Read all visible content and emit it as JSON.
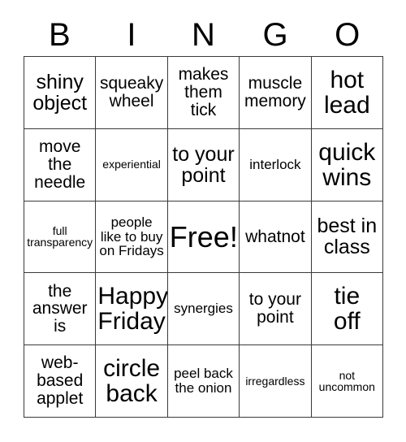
{
  "card": {
    "header_letters": [
      "B",
      "I",
      "N",
      "G",
      "O"
    ],
    "columns": 5,
    "rows": 5,
    "free_space_label": "Free!",
    "border_color": "#3a3a3a",
    "background_color": "#ffffff",
    "text_color": "#000000",
    "cells": [
      {
        "text": "shiny\nobject",
        "size": "l"
      },
      {
        "text": "squeaky\nwheel",
        "size": "m"
      },
      {
        "text": "makes\nthem\ntick",
        "size": "m"
      },
      {
        "text": "muscle\nmemory",
        "size": "m"
      },
      {
        "text": "hot\nlead",
        "size": "xl"
      },
      {
        "text": "move\nthe\nneedle",
        "size": "m"
      },
      {
        "text": "experiential",
        "size": "xs"
      },
      {
        "text": "to your\npoint",
        "size": "l"
      },
      {
        "text": "interlock",
        "size": "s"
      },
      {
        "text": "quick\nwins",
        "size": "xl"
      },
      {
        "text": "full\ntransparency",
        "size": "xs"
      },
      {
        "text": "people\nlike to buy\non Fridays",
        "size": "s"
      },
      {
        "text": "Free!",
        "size": "xxl"
      },
      {
        "text": "whatnot",
        "size": "m"
      },
      {
        "text": "best in\nclass",
        "size": "l"
      },
      {
        "text": "the\nanswer\nis",
        "size": "m"
      },
      {
        "text": "Happy\nFriday",
        "size": "xl"
      },
      {
        "text": "synergies",
        "size": "s"
      },
      {
        "text": "to your\npoint",
        "size": "m"
      },
      {
        "text": "tie\noff",
        "size": "xl"
      },
      {
        "text": "web-\nbased\napplet",
        "size": "m"
      },
      {
        "text": "circle\nback",
        "size": "xl"
      },
      {
        "text": "peel back\nthe onion",
        "size": "s"
      },
      {
        "text": "irregardless",
        "size": "xs"
      },
      {
        "text": "not\nuncommon",
        "size": "xs"
      }
    ]
  }
}
